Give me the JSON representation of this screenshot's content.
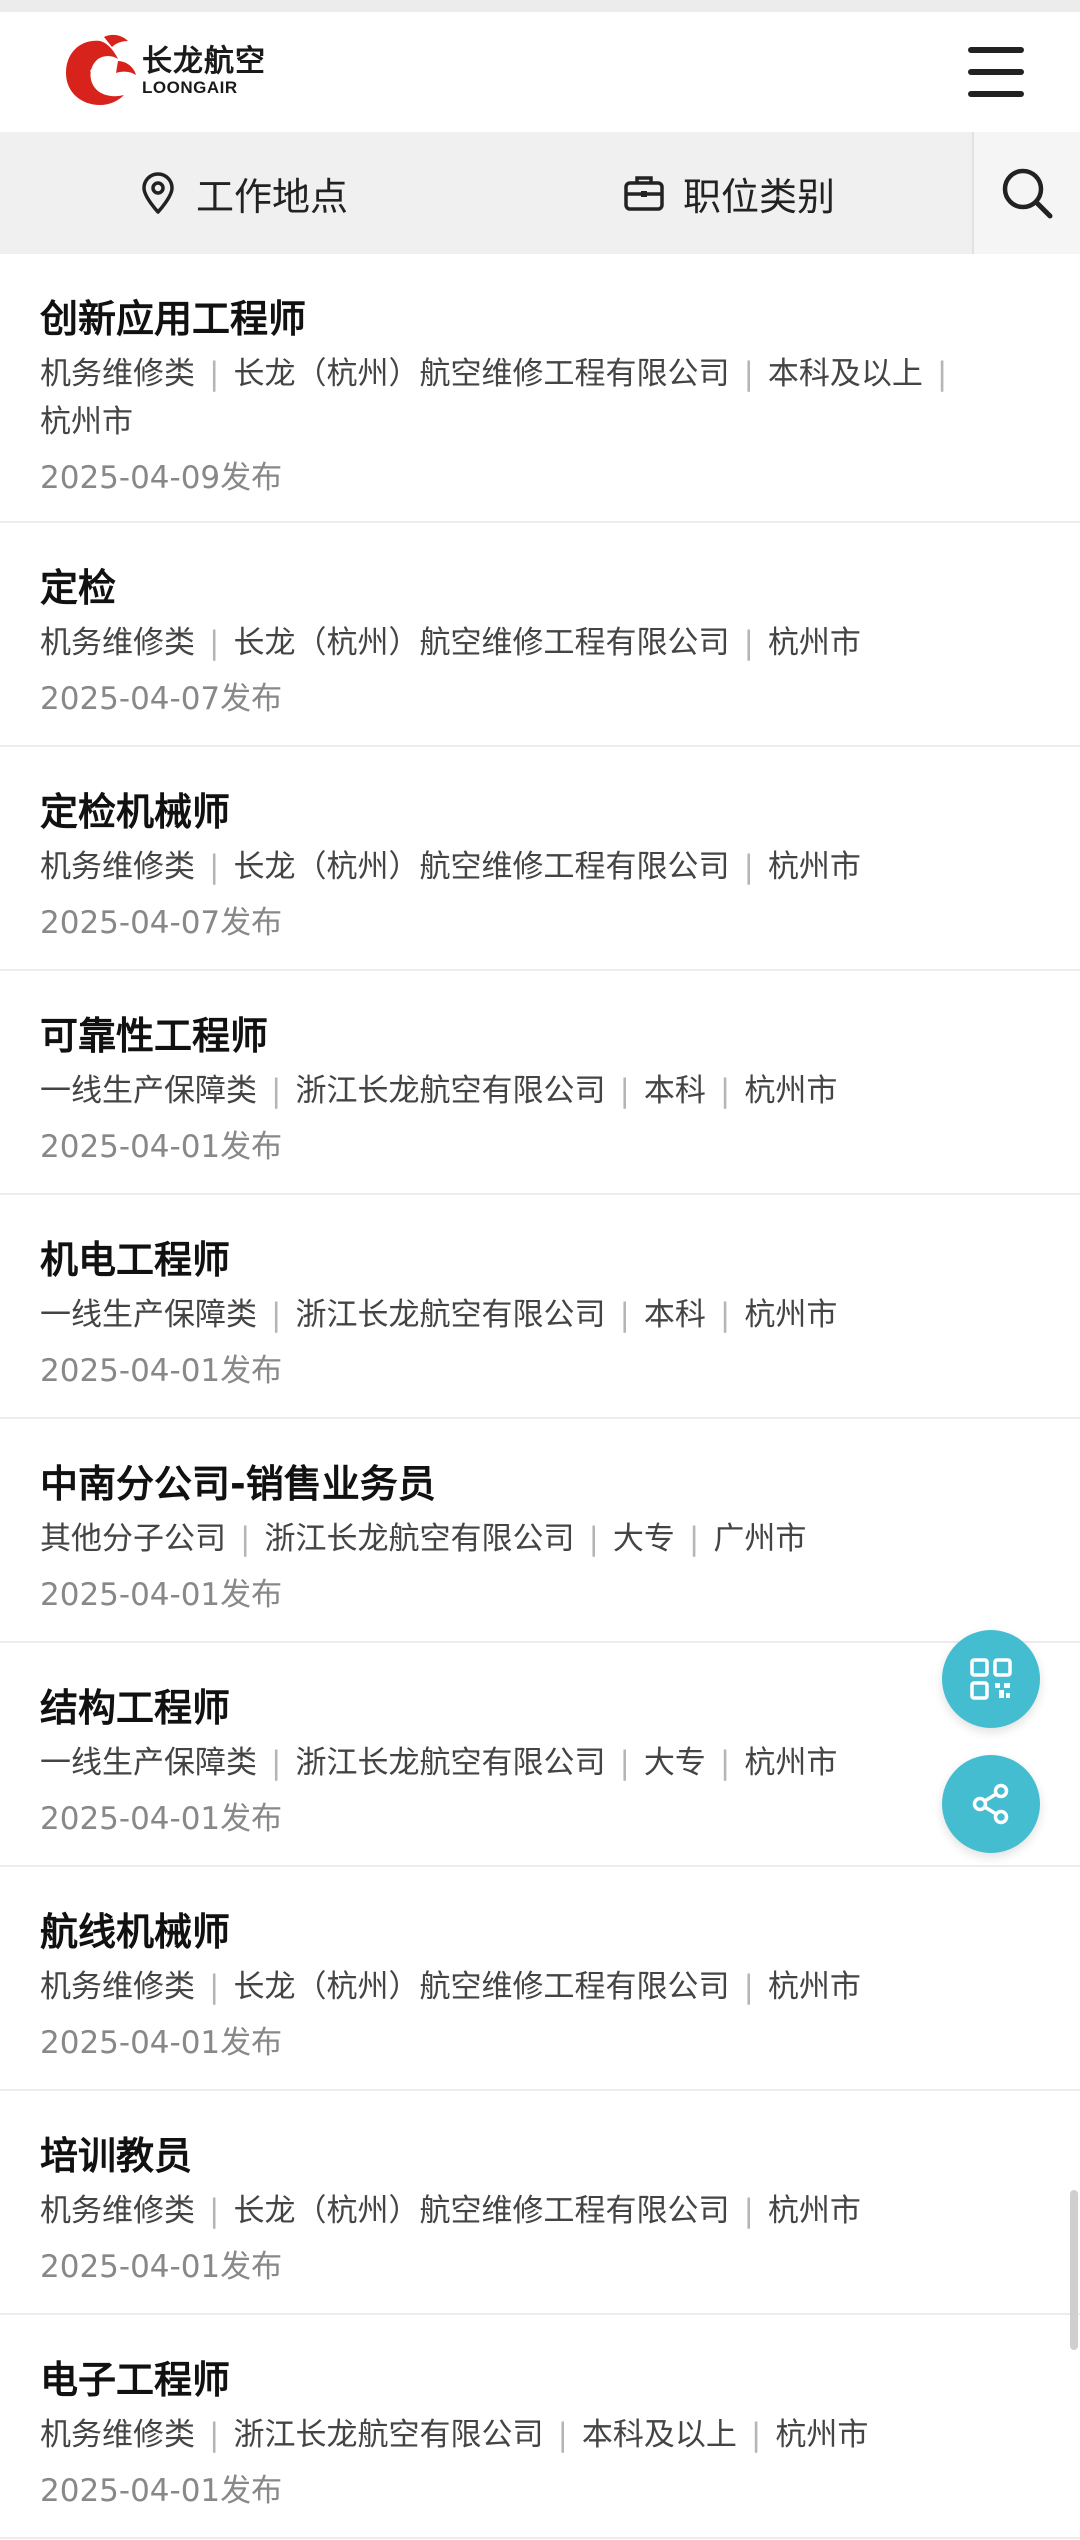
{
  "brand": {
    "name_cn": "长龙航空",
    "name_en": "LOONGAIR"
  },
  "filters": {
    "location_label": "工作地点",
    "category_label": "职位类别"
  },
  "icons": {
    "menu": "hamburger-menu-icon",
    "location": "location-pin-icon",
    "category": "briefcase-icon",
    "search": "search-icon",
    "qr": "qr-code-icon",
    "share": "share-icon"
  },
  "colors": {
    "brand_red": "#d7231c",
    "fab": "#45bdd0"
  },
  "jobs": [
    {
      "title": "创新应用工程师",
      "tags": [
        "机务维修类",
        "长龙（杭州）航空维修工程有限公司",
        "本科及以上",
        "杭州市"
      ],
      "date": "2025-04-09发布"
    },
    {
      "title": "定检",
      "tags": [
        "机务维修类",
        "长龙（杭州）航空维修工程有限公司",
        "杭州市"
      ],
      "date": "2025-04-07发布"
    },
    {
      "title": "定检机械师",
      "tags": [
        "机务维修类",
        "长龙（杭州）航空维修工程有限公司",
        "杭州市"
      ],
      "date": "2025-04-07发布"
    },
    {
      "title": "可靠性工程师",
      "tags": [
        "一线生产保障类",
        "浙江长龙航空有限公司",
        "本科",
        "杭州市"
      ],
      "date": "2025-04-01发布"
    },
    {
      "title": "机电工程师",
      "tags": [
        "一线生产保障类",
        "浙江长龙航空有限公司",
        "本科",
        "杭州市"
      ],
      "date": "2025-04-01发布"
    },
    {
      "title": "中南分公司-销售业务员",
      "tags": [
        "其他分子公司",
        "浙江长龙航空有限公司",
        "大专",
        "广州市"
      ],
      "date": "2025-04-01发布"
    },
    {
      "title": "结构工程师",
      "tags": [
        "一线生产保障类",
        "浙江长龙航空有限公司",
        "大专",
        "杭州市"
      ],
      "date": "2025-04-01发布"
    },
    {
      "title": "航线机械师",
      "tags": [
        "机务维修类",
        "长龙（杭州）航空维修工程有限公司",
        "杭州市"
      ],
      "date": "2025-04-01发布"
    },
    {
      "title": "培训教员",
      "tags": [
        "机务维修类",
        "长龙（杭州）航空维修工程有限公司",
        "杭州市"
      ],
      "date": "2025-04-01发布"
    },
    {
      "title": "电子工程师",
      "tags": [
        "机务维修类",
        "浙江长龙航空有限公司",
        "本科及以上",
        "杭州市"
      ],
      "date": "2025-04-01发布"
    }
  ]
}
